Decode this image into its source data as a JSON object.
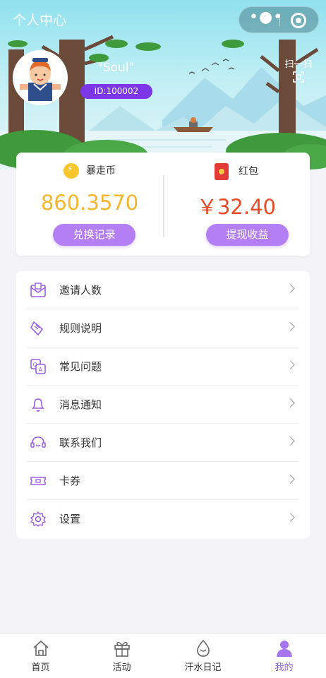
{
  "header": {
    "title": "个人中心",
    "more_icon": "more-dots-icon",
    "close_icon": "target-icon"
  },
  "profile": {
    "username": "\"Soul\"",
    "user_id": "ID:100002",
    "scan_label": "扫一扫"
  },
  "wallet": {
    "coin": {
      "label": "暴走币",
      "amount": "860.3570",
      "button": "兑换记录",
      "color": "#f5b52d"
    },
    "redpack": {
      "label": "红包",
      "amount": "￥32.40",
      "button": "提现收益",
      "color": "#ea4a27"
    }
  },
  "menu": [
    {
      "label": "邀请人数",
      "icon": "invite-envelope-icon"
    },
    {
      "label": "规则说明",
      "icon": "rules-document-icon"
    },
    {
      "label": "常见问题",
      "icon": "faq-qa-icon"
    },
    {
      "label": "消息通知",
      "icon": "bell-icon"
    },
    {
      "label": "联系我们",
      "icon": "headset-icon"
    },
    {
      "label": "卡券",
      "icon": "ticket-icon"
    },
    {
      "label": "设置",
      "icon": "settings-gear-icon"
    }
  ],
  "tabbar": [
    {
      "label": "首页",
      "icon": "home-icon"
    },
    {
      "label": "活动",
      "icon": "gift-icon"
    },
    {
      "label": "汗水日记",
      "icon": "sweat-drop-icon"
    },
    {
      "label": "我的",
      "icon": "user-icon",
      "active": true
    }
  ],
  "colors": {
    "accent": "#9b5ee8",
    "badge": "#7b37e8",
    "hero": "#8fe1ee"
  }
}
